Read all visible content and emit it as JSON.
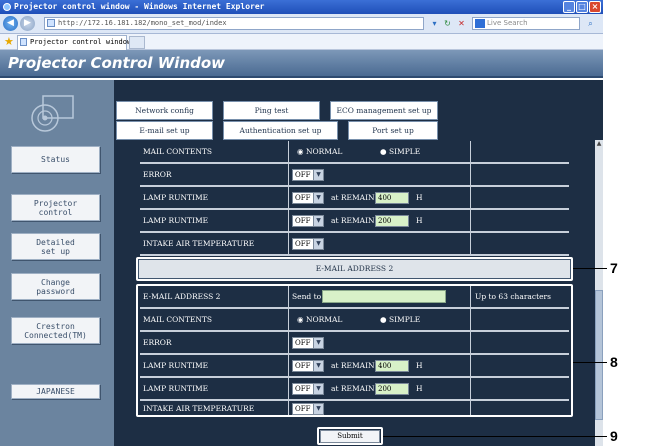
{
  "browser": {
    "title": "Projector control window - Windows Internet Explorer",
    "url": "http://172.16.181.182/mono_set_mod/index",
    "search_placeholder": "Live Search",
    "tab_label": "Projector control window"
  },
  "app": {
    "header": "Projector Control Window"
  },
  "sidebar": {
    "buttons": [
      "Status",
      "Projector\ncontrol",
      "Detailed\nset up",
      "Change\npassword",
      "Crestron\nConnected(TM)",
      "JAPANESE"
    ]
  },
  "tabs": {
    "row1": [
      "Network config",
      "Ping test",
      "ECO management set up"
    ],
    "row2": [
      "E-mail set up",
      "Authentication set up",
      "Port set up"
    ]
  },
  "section1": {
    "mail_contents_label": "MAIL CONTENTS",
    "normal": "NORMAL",
    "simple": "SIMPLE",
    "error_label": "ERROR",
    "error_value": "OFF",
    "lamp1_label": "LAMP RUNTIME",
    "lamp1_value": "OFF",
    "lamp1_remain_label": "at REMAIN",
    "lamp1_remain": "400",
    "lamp1_unit": "H",
    "lamp2_label": "LAMP RUNTIME",
    "lamp2_value": "OFF",
    "lamp2_remain_label": "at REMAIN",
    "lamp2_remain": "200",
    "lamp2_unit": "H",
    "intake_label": "INTAKE AIR TEMPERATURE",
    "intake_value": "OFF"
  },
  "section2": {
    "header": "E-MAIL ADDRESS 2",
    "address_label": "E-MAIL ADDRESS 2",
    "send_to": "Send to",
    "send_value": "",
    "hint": "Up to 63 characters",
    "mail_contents_label": "MAIL CONTENTS",
    "normal": "NORMAL",
    "simple": "SIMPLE",
    "error_label": "ERROR",
    "error_value": "OFF",
    "lamp1_label": "LAMP RUNTIME",
    "lamp1_value": "OFF",
    "lamp1_remain_label": "at REMAIN",
    "lamp1_remain": "400",
    "lamp1_unit": "H",
    "lamp2_label": "LAMP RUNTIME",
    "lamp2_value": "OFF",
    "lamp2_remain_label": "at REMAIN",
    "lamp2_remain": "200",
    "lamp2_unit": "H",
    "intake_label": "INTAKE AIR TEMPERATURE",
    "intake_value": "OFF"
  },
  "submit_label": "Submit",
  "callouts": [
    "7",
    "8",
    "9"
  ]
}
